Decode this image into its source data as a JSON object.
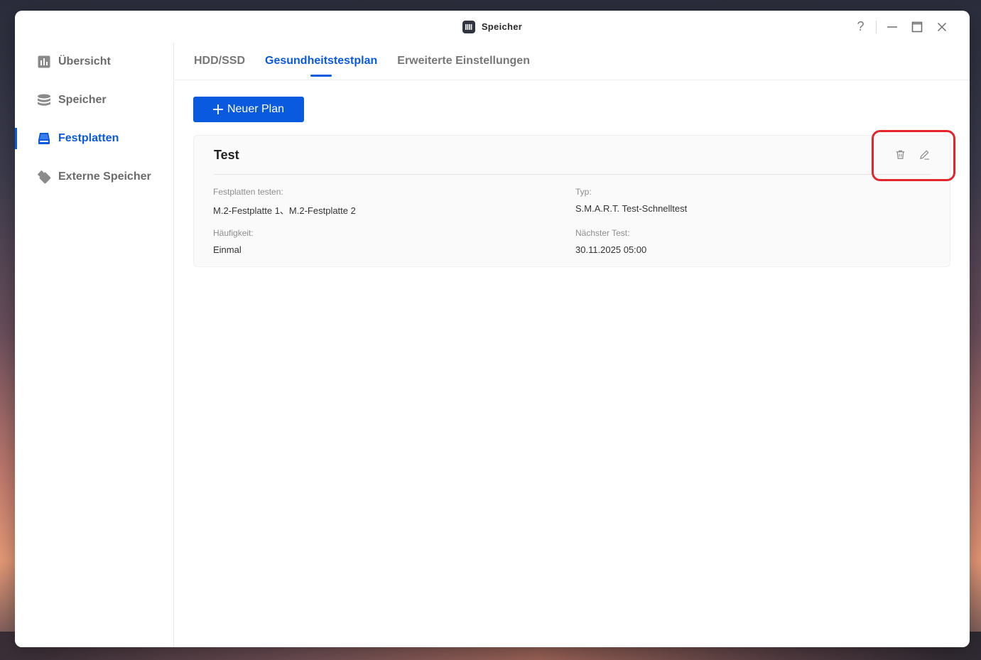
{
  "window": {
    "title": "Speicher",
    "controls": {
      "help": "?",
      "minimize": "—",
      "maximize": "☐",
      "close": "✕"
    }
  },
  "sidebar": {
    "items": [
      {
        "label": "Übersicht",
        "icon": "chart-icon",
        "active": false
      },
      {
        "label": "Speicher",
        "icon": "database-icon",
        "active": false
      },
      {
        "label": "Festplatten",
        "icon": "drive-icon",
        "active": true
      },
      {
        "label": "Externe Speicher",
        "icon": "usb-icon",
        "active": false
      }
    ]
  },
  "tabs": [
    {
      "label": "HDD/SSD",
      "active": false
    },
    {
      "label": "Gesundheitstestplan",
      "active": true
    },
    {
      "label": "Erweiterte Einstellungen",
      "active": false
    }
  ],
  "toolbar": {
    "new_plan_label": "Neuer Plan"
  },
  "plan": {
    "title": "Test",
    "fields": {
      "disks_label": "Festplatten testen:",
      "disks_value": "M.2-Festplatte 1、M.2-Festplatte 2",
      "type_label": "Typ:",
      "type_value": "S.M.A.R.T. Test-Schnelltest",
      "frequency_label": "Häufigkeit:",
      "frequency_value": "Einmal",
      "next_label": "Nächster Test:",
      "next_value": "30.11.2025 05:00"
    }
  },
  "colors": {
    "accent": "#0a5adf",
    "highlight": "#e6242b"
  }
}
